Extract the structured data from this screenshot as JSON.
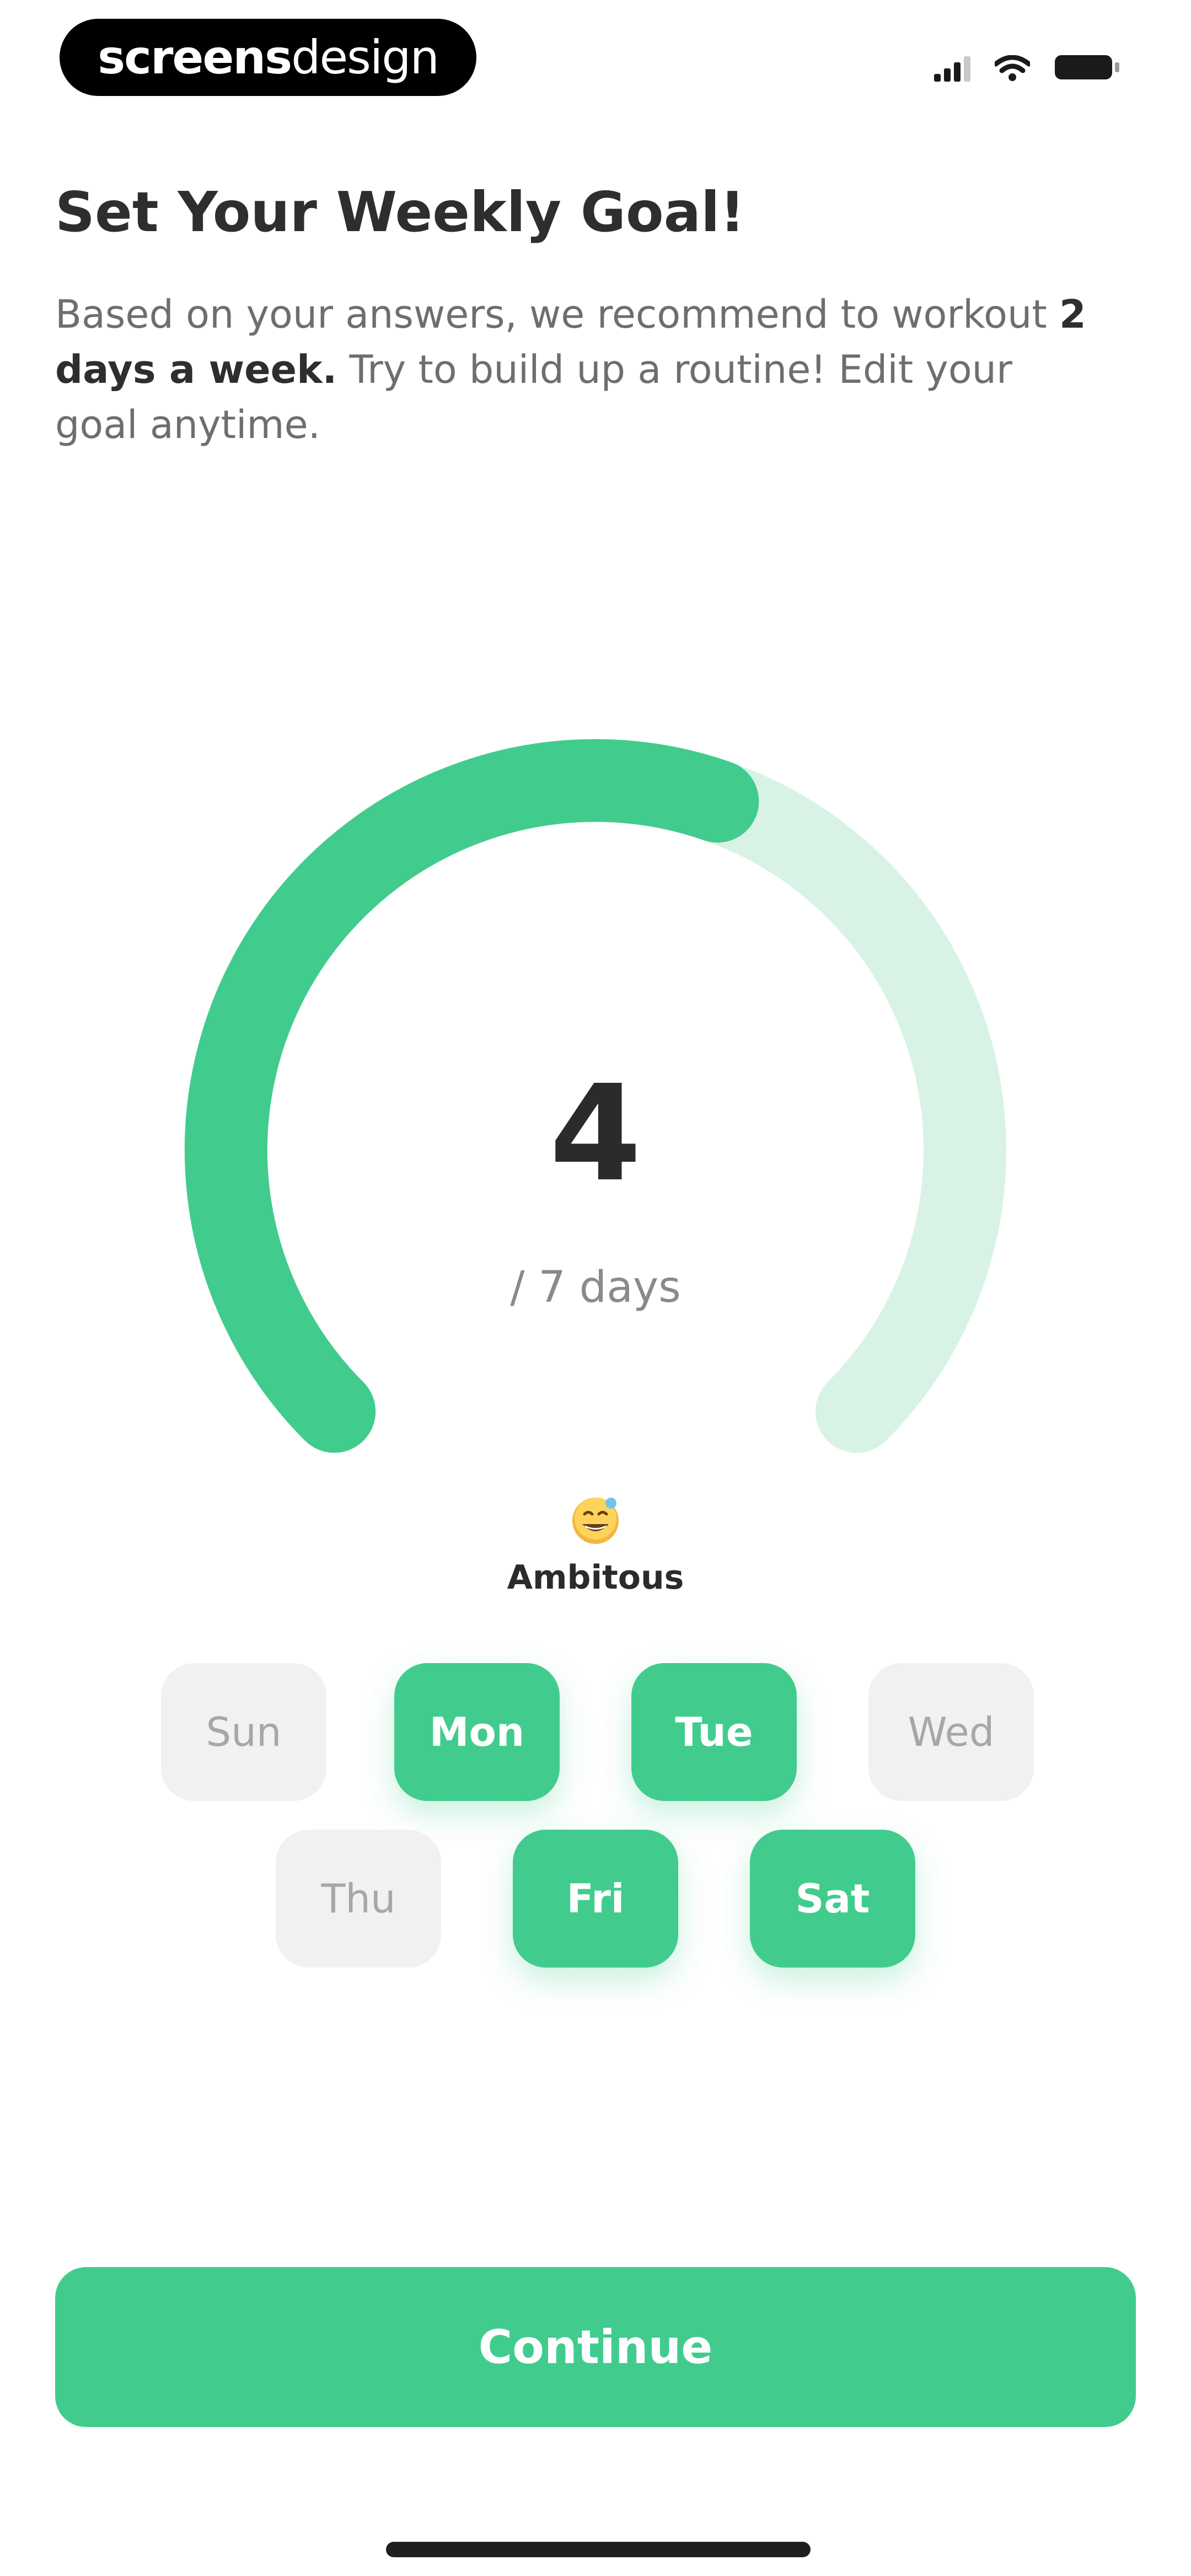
{
  "brand": {
    "strong": "screens",
    "light": "design"
  },
  "status_bar": {
    "icons": [
      "signal-icon",
      "wifi-icon",
      "battery-icon"
    ]
  },
  "header": {
    "title": "Set Your Weekly Goal!",
    "description_before": "Based on your answers, we recommend to workout ",
    "description_highlight": "2 days a week.",
    "description_after": " Try to build up a routine! Edit your goal anytime."
  },
  "goal": {
    "value": "4",
    "value_number": 4,
    "max_days": 7,
    "unit": "/ 7 days",
    "level_label": "Ambitous",
    "level_icon": "grinning-face-emoji-icon"
  },
  "days": [
    {
      "label": "Sun",
      "selected": false
    },
    {
      "label": "Mon",
      "selected": true
    },
    {
      "label": "Tue",
      "selected": true
    },
    {
      "label": "Wed",
      "selected": false
    },
    {
      "label": "Thu",
      "selected": false
    },
    {
      "label": "Fri",
      "selected": true
    },
    {
      "label": "Sat",
      "selected": true
    }
  ],
  "actions": {
    "continue_label": "Continue"
  },
  "colors": {
    "accent": "#41cc8e",
    "accent_light": "#d8f3e5",
    "chip_off_background": "#f1f1f3",
    "chip_off_text": "#a7a7a9",
    "title_text": "#2e2e2e",
    "body_text": "#6e6e6e",
    "background": "#ffffff"
  }
}
